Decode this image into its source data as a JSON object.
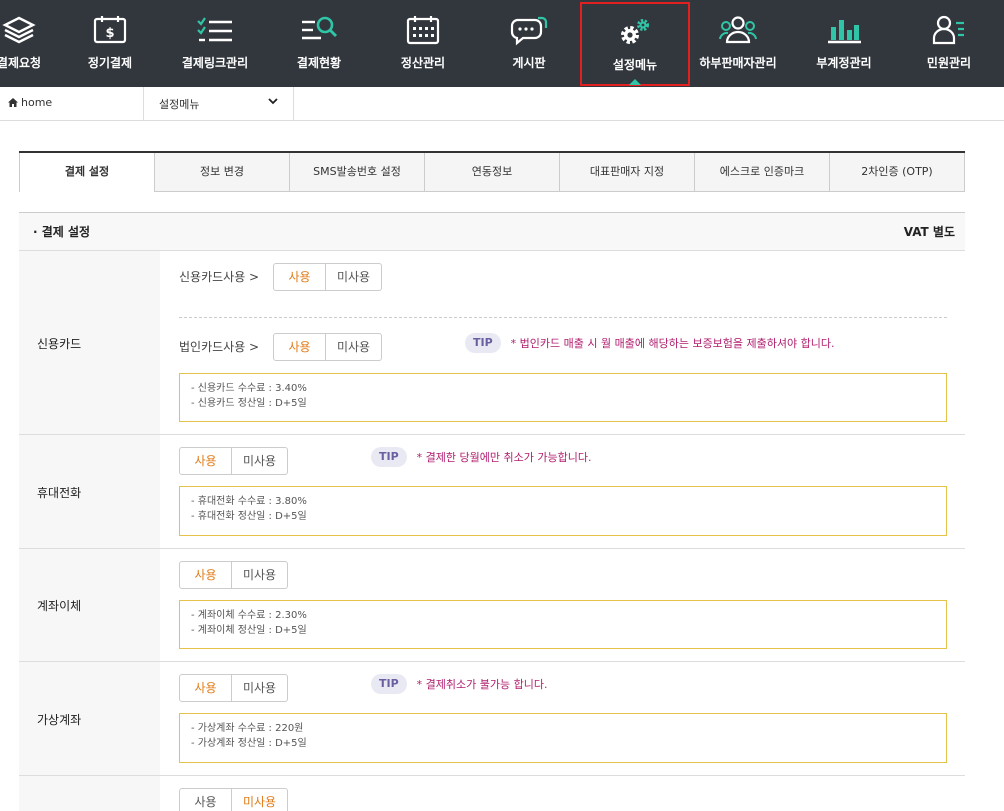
{
  "nav": {
    "items": [
      {
        "label": "결제요청",
        "icon": "layers-icon"
      },
      {
        "label": "정기결제",
        "icon": "bill-icon"
      },
      {
        "label": "결제링크관리",
        "icon": "checklist-icon"
      },
      {
        "label": "결제현황",
        "icon": "search-list-icon"
      },
      {
        "label": "정산관리",
        "icon": "calendar-icon"
      },
      {
        "label": "게시판",
        "icon": "chat-icon"
      },
      {
        "label": "설정메뉴",
        "icon": "gear-icon"
      },
      {
        "label": "하부판매자관리",
        "icon": "users-icon"
      },
      {
        "label": "부계정관리",
        "icon": "bar-chart-icon"
      },
      {
        "label": "민원관리",
        "icon": "person-list-icon"
      }
    ],
    "active_index": 6
  },
  "breadcrumb": {
    "home": "home",
    "current": "설정메뉴"
  },
  "tabs": [
    "결제 설정",
    "정보 변경",
    "SMS발송번호 설정",
    "연동정보",
    "대표판매자 지정",
    "에스크로 인증마크",
    "2차인증 (OTP)"
  ],
  "section": {
    "title": "· 결제 설정",
    "vat": "VAT 별도"
  },
  "toggle": {
    "use": "사용",
    "unused": "미사용"
  },
  "tip_label": "TIP",
  "credit": {
    "label": "신용카드",
    "personal_label": "신용카드사용 >",
    "corporate_label": "법인카드사용 >",
    "tip": "* 법인카드 매출 시 월 매출에 해당하는 보증보험을 제출하셔야 합니다.",
    "info": [
      "- 신용카드 수수료 : 3.40%",
      "- 신용카드 정산일 : D+5일"
    ]
  },
  "mobile": {
    "label": "휴대전화",
    "tip": "* 결제한 당월에만 취소가 가능합니다.",
    "info": [
      "- 휴대전화 수수료 : 3.80%",
      "- 휴대전화 정산일 : D+5일"
    ]
  },
  "transfer": {
    "label": "계좌이체",
    "info": [
      "- 계좌이체 수수료 : 2.30%",
      "- 계좌이체 정산일 : D+5일"
    ]
  },
  "virtual": {
    "label": "가상계좌",
    "tip": "* 결제취소가 불가능 합니다.",
    "info": [
      "- 가상계좌 수수료 : 220원",
      "- 가상계좌 정산일 : D+5일"
    ]
  },
  "colors": {
    "nav_bg": "#32373d",
    "accent": "#2fc5a6",
    "active_border": "#e32020",
    "selected": "#e07b17",
    "tip_text": "#b01d6e",
    "info_border": "#e6c24a"
  }
}
